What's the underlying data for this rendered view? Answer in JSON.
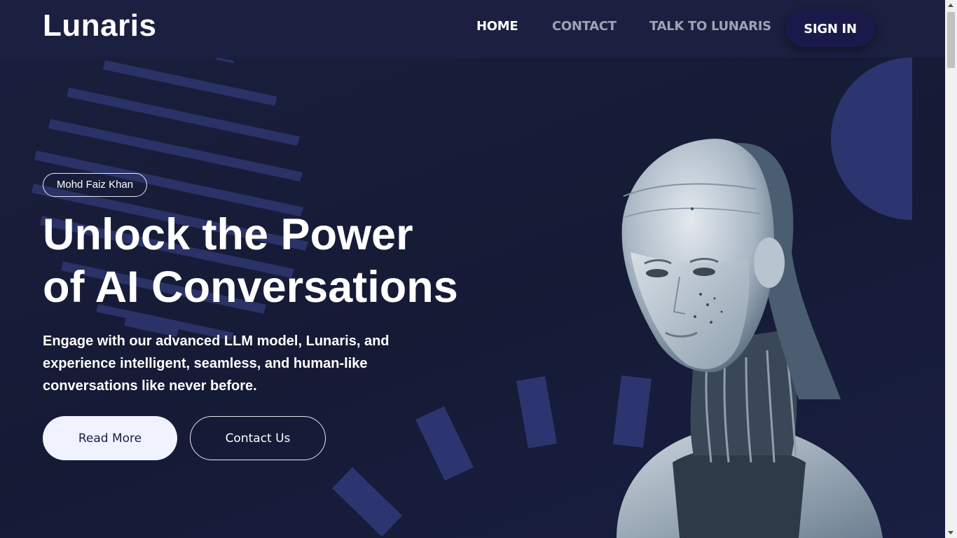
{
  "header": {
    "logo": "Lunaris",
    "nav": {
      "home": "HOME",
      "contact": "CONTACT",
      "talk": "TALK TO LUNARIS"
    },
    "sign_in": "SIGN IN"
  },
  "hero": {
    "badge": "Mohd Faiz Khan",
    "headline_line1": "Unlock the Power",
    "headline_line2": "of AI Conversations",
    "subtext": "Engage with our advanced LLM model, Lunaris, and experience intelligent, seamless, and human-like conversations like never before.",
    "read_more": "Read More",
    "contact_us": "Contact Us"
  },
  "colors": {
    "background": "#161a36",
    "header": "#1b2040",
    "signin_button": "#1a1a4a",
    "primary_button": "#f0f3ff",
    "decor_accent": "#2d3570"
  },
  "icons": [
    "robot-illustration"
  ]
}
